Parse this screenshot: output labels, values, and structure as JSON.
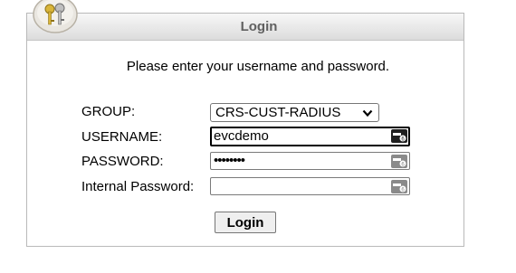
{
  "window": {
    "title": "Login"
  },
  "prompt": "Please enter your username and password.",
  "form": {
    "group": {
      "label": "GROUP:",
      "selected": "CRS-CUST-RADIUS"
    },
    "username": {
      "label": "USERNAME:",
      "value": "evcdemo"
    },
    "password": {
      "label": "PASSWORD:",
      "value": "••••••••"
    },
    "internal_password": {
      "label": "Internal Password:",
      "value": ""
    }
  },
  "login_button": "Login",
  "icons": {
    "logo": "keys-icon",
    "field_key": "password-manager-key-icon",
    "select_arrow": "chevron-down-icon"
  }
}
